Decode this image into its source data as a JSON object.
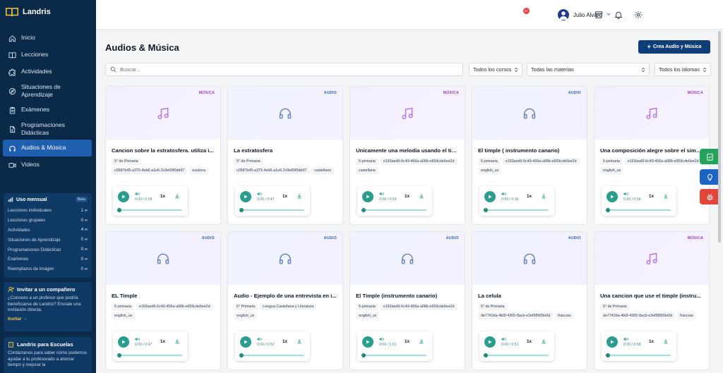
{
  "brand": {
    "name": "Landris"
  },
  "nav": [
    {
      "label": "Inicio",
      "icon": "home-icon",
      "active": false
    },
    {
      "label": "Lecciones",
      "icon": "book-icon",
      "active": false
    },
    {
      "label": "Actividades",
      "icon": "puzzle-icon",
      "active": false
    },
    {
      "label": "Situaciones de Aprendizaje",
      "icon": "compass-icon",
      "active": false
    },
    {
      "label": "Exámenes",
      "icon": "clipboard-icon",
      "active": false
    },
    {
      "label": "Programaciones Didácticas",
      "icon": "document-icon",
      "active": false
    },
    {
      "label": "Audios & Música",
      "icon": "headphones-icon",
      "active": true
    },
    {
      "label": "Videos",
      "icon": "video-icon",
      "active": false
    }
  ],
  "usage": {
    "title": "Uso mensual",
    "badge": "Beta",
    "rows": [
      {
        "label": "Lecciones individuales",
        "value": "1 ∞"
      },
      {
        "label": "Lecciones grupales",
        "value": "0 ∞"
      },
      {
        "label": "Actividades",
        "value": "4 ∞"
      },
      {
        "label": "Situaciones de Aprendizaje",
        "value": "0 ∞"
      },
      {
        "label": "Programaciones Didácticas",
        "value": "0 ∞"
      },
      {
        "label": "Exámenes",
        "value": "0 ∞"
      },
      {
        "label": "Reemplazos de Imagen",
        "value": "0 ∞"
      }
    ]
  },
  "invite": {
    "title": "Invitar a un compañero",
    "text": "¿Conoces a un profesor que podría beneficiarse de Landris? Envíale una invitación directa.",
    "link": "Invitar →"
  },
  "schools": {
    "title": "Landris para Escuelas",
    "text": "Contáctanos para saber cómo podemos ayudar a tu profesorado a ahorrar tiempo y mejorar la"
  },
  "topbar": {
    "bell_count": "9+",
    "username": "Julio Alvaro"
  },
  "page": {
    "title": "Audios & Música",
    "create_label": "Crea Audio y Música"
  },
  "filters": {
    "search_placeholder": "Buscar...",
    "courses": "Todos los cursos",
    "subjects": "Todas las materias",
    "languages": "Todos los idiomas"
  },
  "cards": [
    {
      "type": "MÚSICA",
      "kind": "music",
      "title": "Cancion sobre la estratosfera. utiliza i...",
      "chips": [
        "5° de Primaria",
        "c0687b45-a375-4eb6-a1e6-2c9e60f0dd47",
        "euskera"
      ],
      "time": "0:00 / 0:58"
    },
    {
      "type": "AUDIO",
      "kind": "audio",
      "title": "La estratosfera",
      "chips": [
        "5° de Primaria",
        "c0687b45-a375-4eb6-a1e6-2c9e60f0dd47",
        "castellano"
      ],
      "time": "0:00 / 0:47"
    },
    {
      "type": "MÚSICA",
      "kind": "music",
      "title": "Unicamente una melodia usando el tim...",
      "chips": [
        "5-primaria",
        "e163aed6-6c49-456a-a08b-e659cde6ee2d",
        "castellano"
      ],
      "time": "0:00 / 0:59"
    },
    {
      "type": "AUDIO",
      "kind": "audio",
      "title": "El timple ( instrumento canario)",
      "chips": [
        "5-primaria",
        "e163aed6-6c49-456a-a08b-e659cde6ee2d",
        "english_ux"
      ],
      "time": "0:00 / 0:35"
    },
    {
      "type": "MÚSICA",
      "kind": "music",
      "title": "Una composición alegre sobre el simpl...",
      "chips": [
        "5-primaria",
        "e163aed6-6c49-456a-a08b-e659cde6ee2d",
        "english_ux"
      ],
      "time": "0:00 / 0:58"
    },
    {
      "type": "AUDIO",
      "kind": "audio",
      "title": "EL Timple",
      "chips": [
        "5-primaria",
        "e163aed6-6c49-456a-a08b-e659cde6ee2d",
        "english_ux"
      ],
      "time": "0:00 / 0:47"
    },
    {
      "type": "AUDIO",
      "kind": "audio",
      "title": "Audio - Ejemplo de una entrevista en i...",
      "chips": [
        "5° Primaria",
        "Lengua Castellana y Literatura",
        "english_ux"
      ],
      "time": "0:00 / 0:52"
    },
    {
      "type": "AUDIO",
      "kind": "audio",
      "title": "El Timple (instrumento canario)",
      "chips": [
        "5-primaria",
        "e163aed6-6c49-456a-a08b-e659cde6ee2d",
        "english_ux"
      ],
      "time": "0:00 / 1:01"
    },
    {
      "type": "AUDIO",
      "kind": "audio",
      "title": "La celula",
      "chips": [
        "5° de Primaria",
        "de7742da-4b0f-4305-8acb-e3ef98909e0d",
        "francais"
      ],
      "time": "0:00 / 0:51"
    },
    {
      "type": "MÚSICA",
      "kind": "music",
      "title": "Una cancion que use el timple (instru...",
      "chips": [
        "5° de Primaria",
        "de7742da-4b0f-4305-8acb-e3ef98909e0d",
        "francais"
      ],
      "time": "0:00 / 0:58"
    }
  ],
  "player": {
    "speed": "1x"
  },
  "colors": {
    "sidebar": "#0b2a4a",
    "primary": "#0e3d77",
    "teal": "#2a9d8f",
    "audio_tag": "#2f62c6",
    "music_tag": "#a435c2"
  }
}
